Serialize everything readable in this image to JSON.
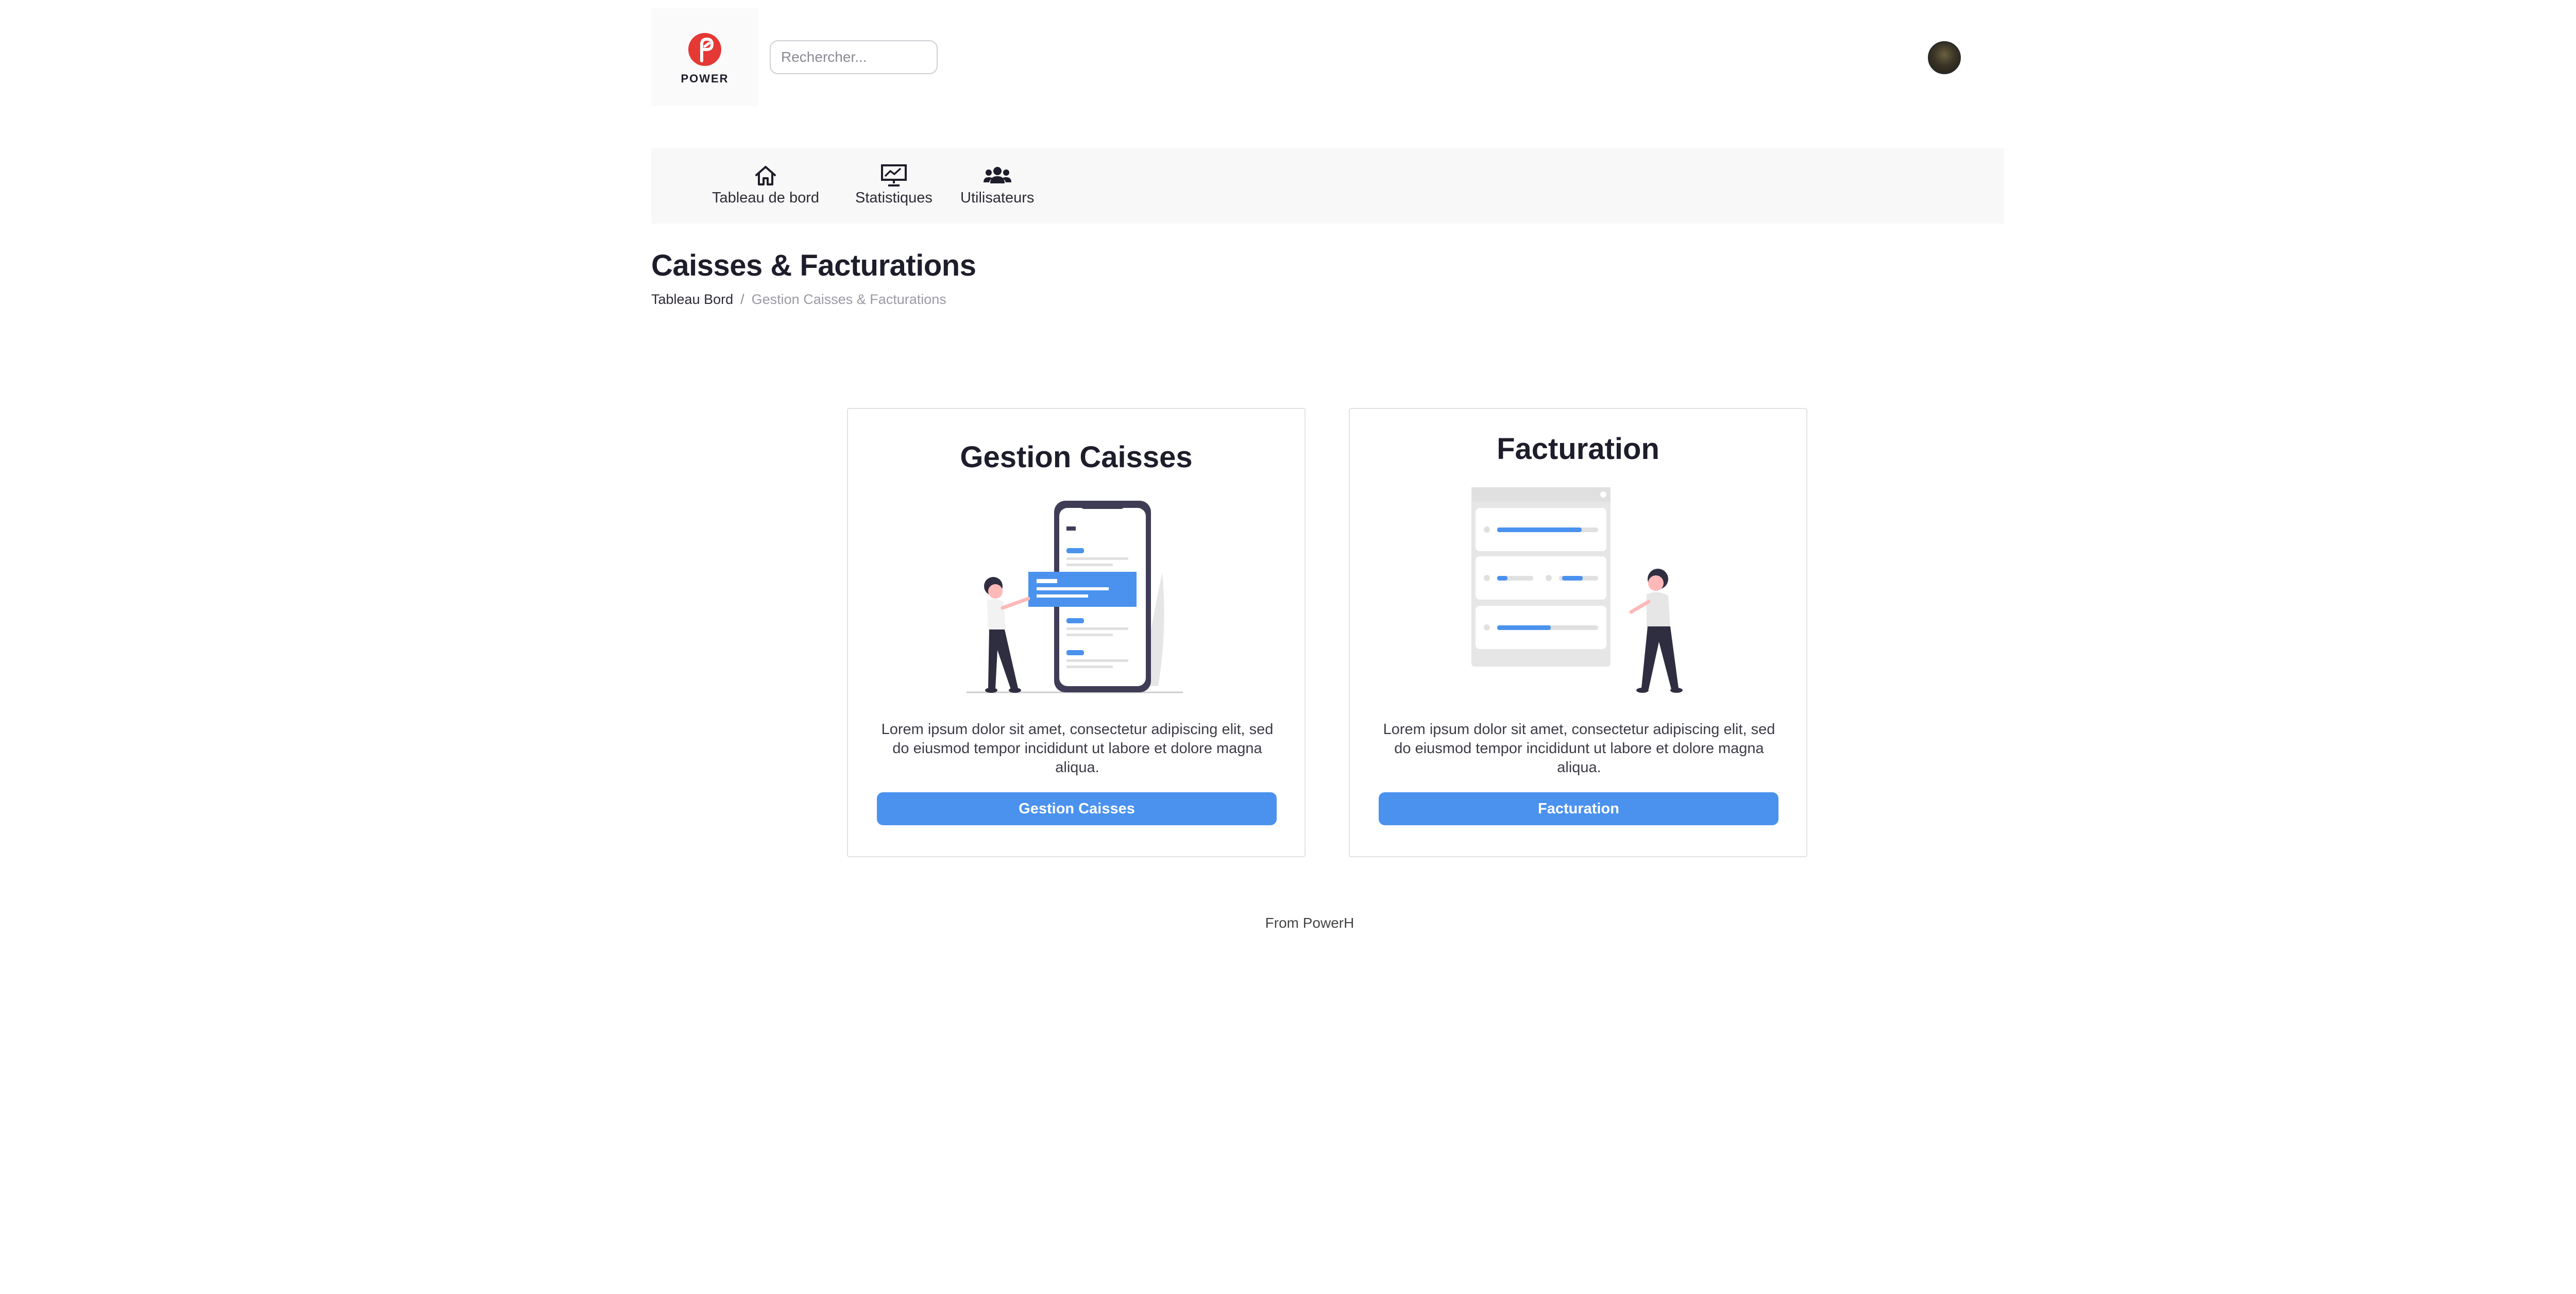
{
  "brand": {
    "name": "POWER",
    "color": "#e53935"
  },
  "search": {
    "placeholder": "Rechercher..."
  },
  "nav": {
    "items": [
      {
        "label": "Tableau de bord",
        "icon": "home-icon"
      },
      {
        "label": "Statistiques",
        "icon": "statistics-board-icon"
      },
      {
        "label": "Utilisateurs",
        "icon": "users-icon"
      }
    ]
  },
  "page": {
    "title": "Caisses & Facturations",
    "breadcrumb": {
      "parent": "Tableau Bord",
      "separator": "/",
      "current": "Gestion Caisses & Facturations"
    }
  },
  "cards": [
    {
      "title": "Gestion Caisses",
      "description": "Lorem ipsum dolor sit amet, consectetur adipiscing elit, sed do eiusmod tempor incididunt ut labore et dolore magna aliqua.",
      "button_label": "Gestion Caisses",
      "illustration": "person-with-mobile-app-illustration"
    },
    {
      "title": "Facturation",
      "description": "Lorem ipsum dolor sit amet, consectetur adipiscing elit, sed do eiusmod tempor incididunt ut labore et dolore magna aliqua.",
      "button_label": "Facturation",
      "illustration": "person-with-settings-panel-illustration"
    }
  ],
  "footer": {
    "text": "From PowerH"
  },
  "colors": {
    "accent": "#4a92ee",
    "nav_bg": "#f8f8f8",
    "dark": "#1d1d2b"
  }
}
